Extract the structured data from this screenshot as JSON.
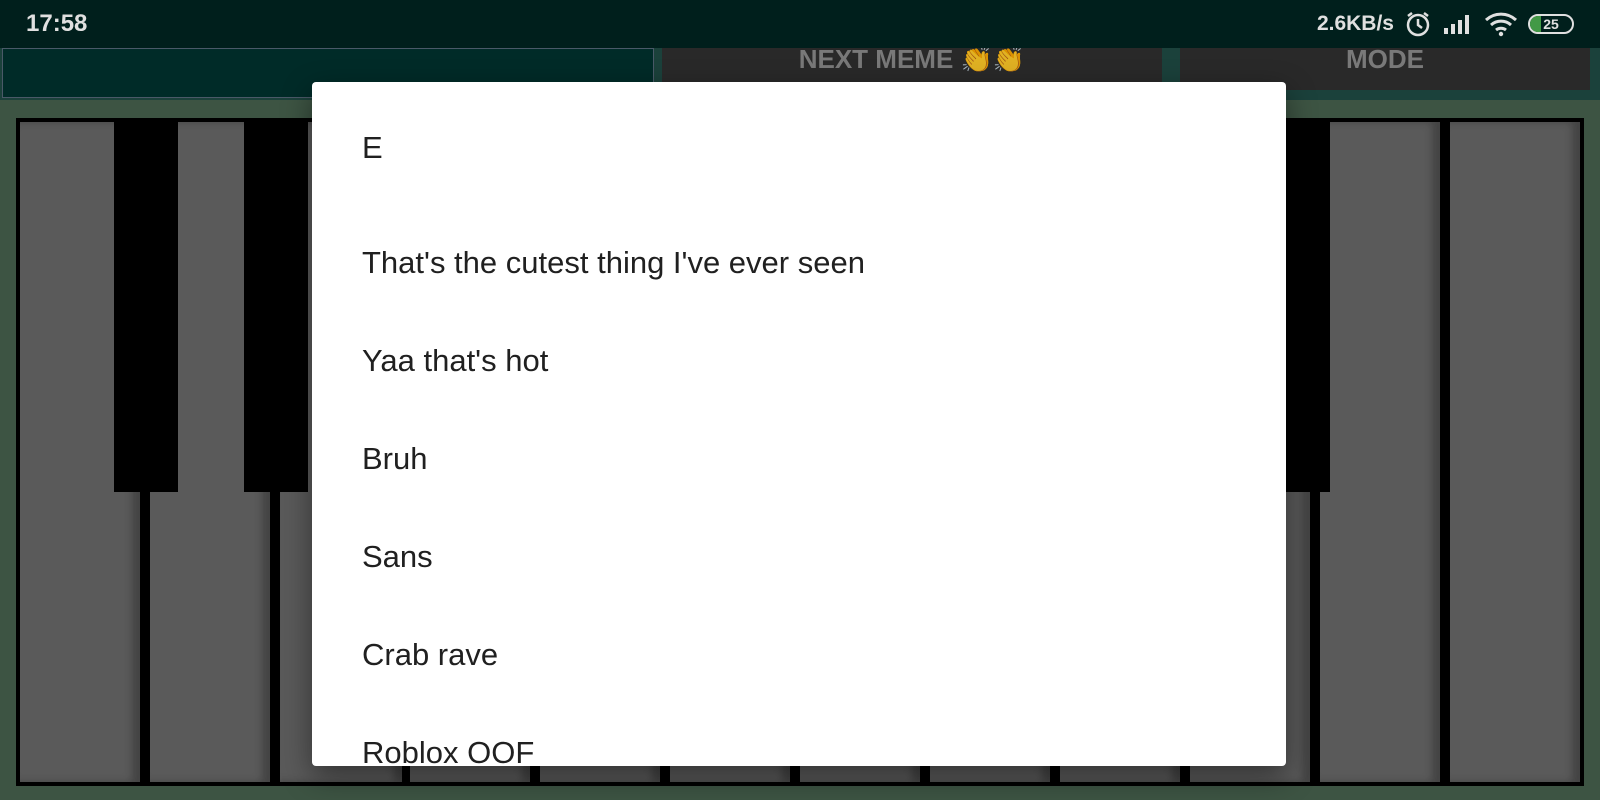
{
  "status_bar": {
    "time": "17:58",
    "network_speed": "2.6KB/s",
    "battery_level": "25",
    "icons": [
      "alarm-icon",
      "signal-icon",
      "wifi-icon",
      "battery-icon"
    ]
  },
  "top_controls": {
    "next_meme_label": "NEXT MEME 👏👏",
    "mode_label": "MODE"
  },
  "piano": {
    "white_keys": 12,
    "colors": {
      "white_key": "#676767",
      "black_key": "#000000",
      "background": "#46604d"
    }
  },
  "dialog": {
    "options": [
      {
        "label": "E"
      },
      {
        "label": "That's the cutest thing I've ever seen"
      },
      {
        "label": "Yaa that's hot"
      },
      {
        "label": "Bruh"
      },
      {
        "label": "Sans"
      },
      {
        "label": "Crab rave"
      },
      {
        "label": "Roblox OOF"
      }
    ]
  }
}
